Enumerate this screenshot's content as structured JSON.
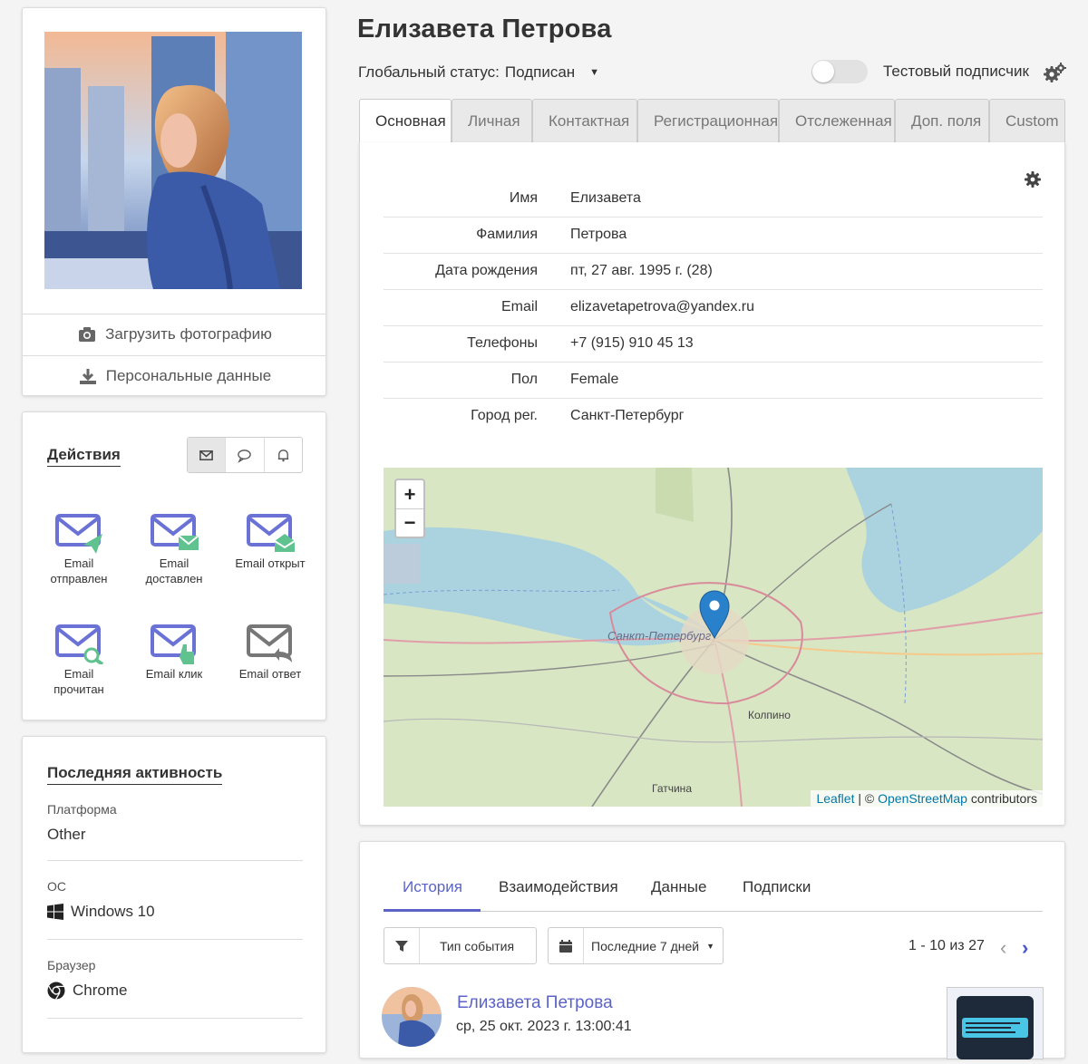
{
  "contact": {
    "name": "Елизавета Петрова",
    "status_label": "Глобальный статус:",
    "status_value": "Подписан",
    "test_label": "Тестовый подписчик"
  },
  "sidebar": {
    "upload_label": "Загрузить фотографию",
    "personal_label": "Персональные данные",
    "actions": {
      "title": "Действия",
      "items": [
        {
          "label": "Email отправлен"
        },
        {
          "label": "Email доставлен"
        },
        {
          "label": "Email открыт"
        },
        {
          "label": "Email прочитан"
        },
        {
          "label": "Email клик"
        },
        {
          "label": "Email ответ"
        }
      ]
    },
    "activity": {
      "title": "Последняя активность",
      "platform_label": "Платформа",
      "platform_value": "Other",
      "os_label": "ОС",
      "os_value": "Windows 10",
      "browser_label": "Браузер",
      "browser_value": "Chrome"
    }
  },
  "tabs": [
    "Основная",
    "Личная",
    "Контактная",
    "Регистрационная",
    "Отслеженная",
    "Доп. поля",
    "Custom"
  ],
  "fields": [
    {
      "label": "Имя",
      "value": "Елизавета"
    },
    {
      "label": "Фамилия",
      "value": "Петрова"
    },
    {
      "label": "Дата рождения",
      "value": "пт, 27 авг. 1995 г. (28)"
    },
    {
      "label": "Email",
      "value": "elizavetapetrova@yandex.ru"
    },
    {
      "label": "Телефоны",
      "value": "+7 (915) 910 45 13"
    },
    {
      "label": "Пол",
      "value": "Female"
    },
    {
      "label": "Город рег.",
      "value": "Санкт-Петербург"
    }
  ],
  "map": {
    "zoom_in": "+",
    "zoom_out": "−",
    "city_label": "Санкт-Петербург",
    "kolpino": "Колпино",
    "gatchina": "Гатчина",
    "attrib_leaflet": "Leaflet",
    "attrib_sep": " | © ",
    "attrib_osm": "OpenStreetMap",
    "attrib_tail": " contributors"
  },
  "history": {
    "tabs": [
      "История",
      "Взаимодействия",
      "Данные",
      "Подписки"
    ],
    "filter_type": "Тип события",
    "filter_period": "Последние 7 дней",
    "pager": "1 - 10 из 27",
    "event": {
      "name": "Елизавета Петрова",
      "date": "ср, 25 окт. 2023 г. 13:00:41"
    }
  },
  "colors": {
    "accent": "#5b63c8",
    "icon": "#6b72d6",
    "badge_green": "#5fc28f"
  }
}
